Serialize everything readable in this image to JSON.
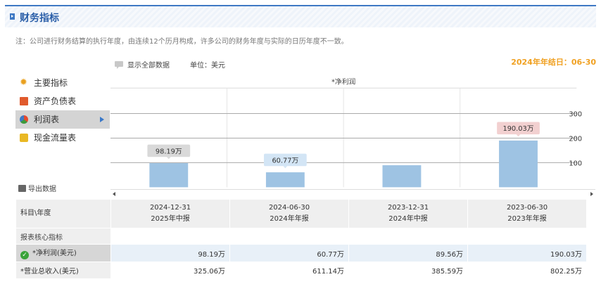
{
  "header": {
    "title": "财务指标"
  },
  "note": "注：公司进行财务结算的执行年度，由连续12个历月构成，许多公司的财务年度与实际的日历年度不一致。",
  "options": {
    "show_all_label": "显示全部数据",
    "unit_label": "单位：美元"
  },
  "fiscal_year_end": "2024年年结日：06-30",
  "sidebar": {
    "items": [
      {
        "label": "主要指标",
        "icon": "star-icon"
      },
      {
        "label": "资产负债表",
        "icon": "document-icon"
      },
      {
        "label": "利润表",
        "icon": "pie-chart-icon",
        "active": true
      },
      {
        "label": "现金流量表",
        "icon": "coins-icon"
      }
    ],
    "export_label": "导出数据"
  },
  "chart_data": {
    "type": "bar",
    "title": "*净利润",
    "categories": [
      "2024-12-31",
      "2024-06-30",
      "2023-12-31",
      "2023-06-30"
    ],
    "values": [
      98.19,
      60.77,
      89.56,
      190.03
    ],
    "data_labels": [
      "98.19万",
      "60.77万",
      "",
      "190.03万"
    ],
    "yticks": [
      100,
      200,
      300
    ],
    "ylim": [
      0,
      400
    ],
    "grid": true,
    "bar_color": "#9ec3e3",
    "label_colors": [
      "#d9d9d9",
      "#d3e5f5",
      "",
      "#f2d0d0"
    ]
  },
  "table": {
    "header_label": "科目\\年度",
    "columns": [
      {
        "date": "2024-12-31",
        "period": "2025年中报"
      },
      {
        "date": "2024-06-30",
        "period": "2024年年报"
      },
      {
        "date": "2023-12-31",
        "period": "2024年中报"
      },
      {
        "date": "2023-06-30",
        "period": "2023年年报"
      }
    ],
    "section_label": "报表核心指标",
    "rows": [
      {
        "label": "*净利润(美元)",
        "values": [
          "98.19万",
          "60.77万",
          "89.56万",
          "190.03万"
        ]
      },
      {
        "label": "*营业总收入(美元)",
        "values": [
          "325.06万",
          "611.14万",
          "385.59万",
          "802.25万"
        ]
      }
    ]
  }
}
